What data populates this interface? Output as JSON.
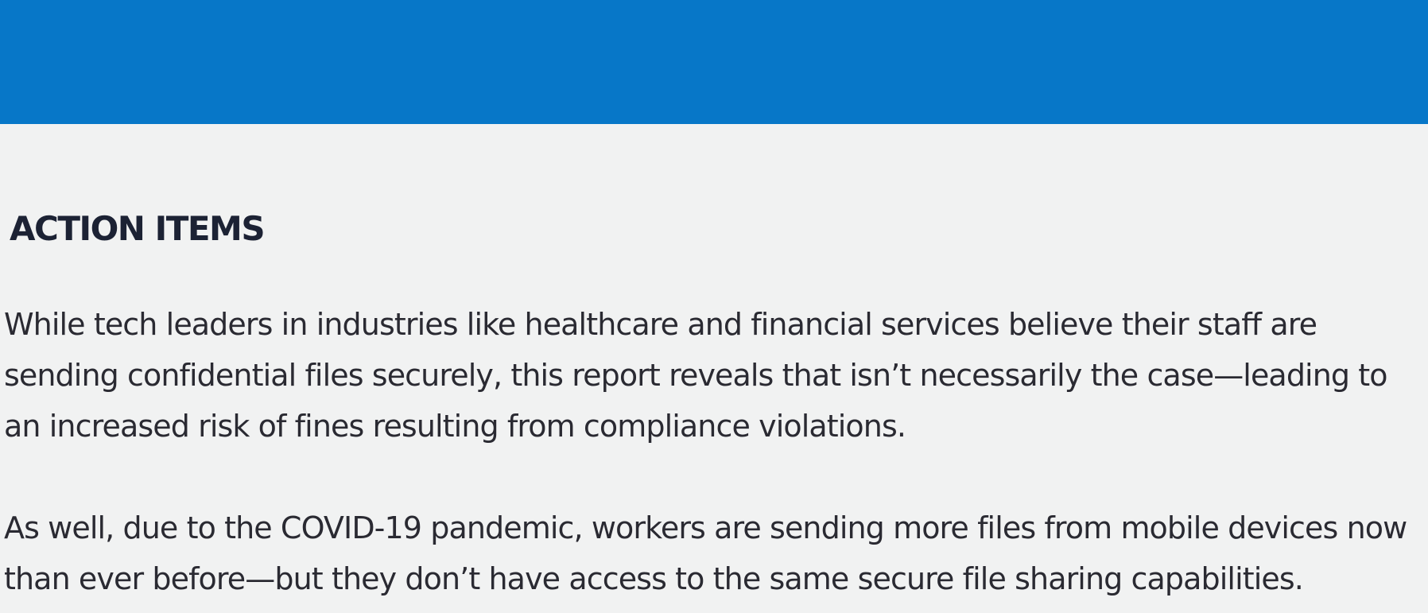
{
  "banner": {
    "color": "#0777c8"
  },
  "section": {
    "heading": "ACTION ITEMS",
    "paragraphs": [
      {
        "lines": [
          "While tech leaders in industries like healthcare and financial services believe their staff are",
          "sending confidential files securely, this report reveals that isn’t necessarily the case—leading to",
          "an increased risk of fines resulting from compliance violations."
        ]
      },
      {
        "lines": [
          "As well, due to the COVID-19 pandemic, workers are sending more files from mobile devices now",
          "than ever before—but they don’t have access to the same secure file sharing capabilities."
        ]
      }
    ]
  }
}
